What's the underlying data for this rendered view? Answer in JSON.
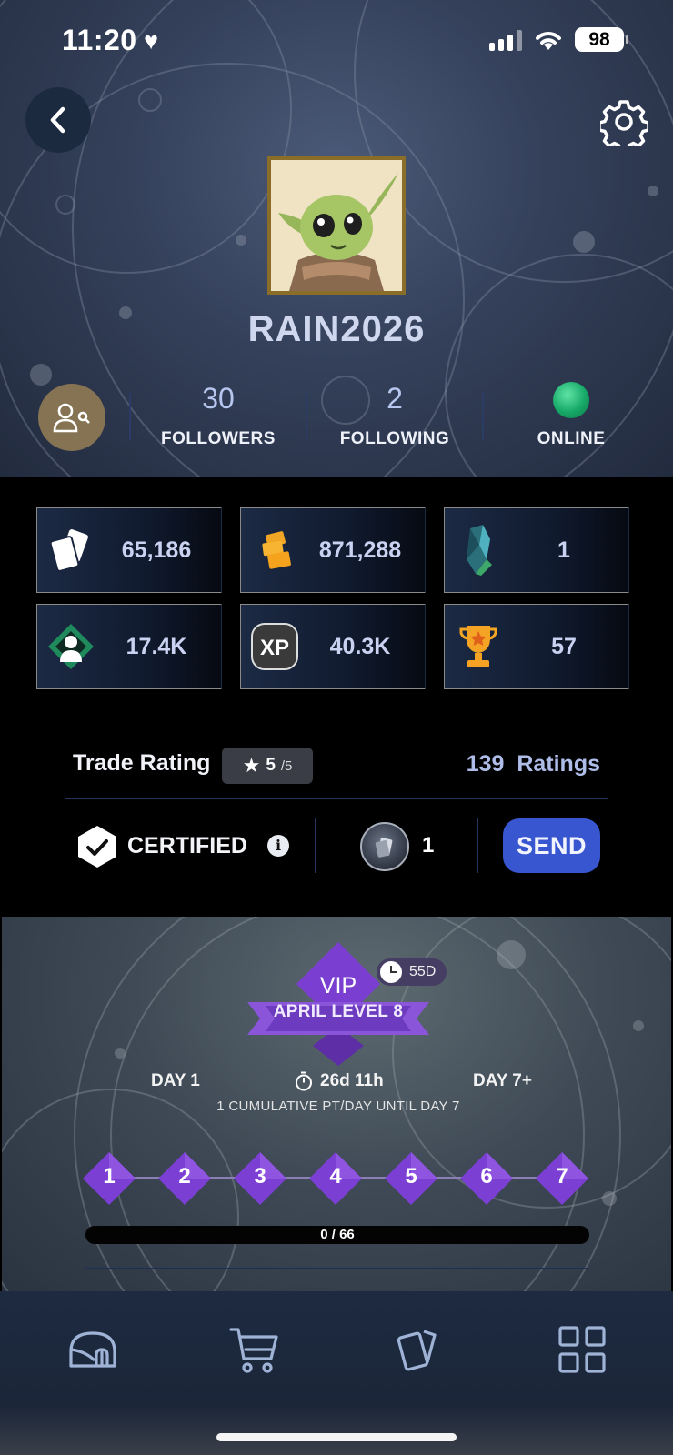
{
  "status_bar": {
    "time": "11:20",
    "battery": "98"
  },
  "profile": {
    "username": "RAIN2026",
    "stats": [
      {
        "value": "30",
        "label": "FOLLOWERS"
      },
      {
        "value": "2",
        "label": "FOLLOWING"
      },
      {
        "value": "",
        "label": "ONLINE"
      }
    ],
    "online_color": "#1fb872"
  },
  "currencies": [
    {
      "icon": "cards-icon",
      "value": "65,186"
    },
    {
      "icon": "ticket-icon",
      "value": "871,288"
    },
    {
      "icon": "crystal-icon",
      "value": "1"
    },
    {
      "icon": "collector-score-icon",
      "value": "17.4K"
    },
    {
      "icon": "xp-icon",
      "value": "40.3K"
    },
    {
      "icon": "trophy-icon",
      "value": "57"
    }
  ],
  "trade": {
    "title": "Trade Rating",
    "rating": "5",
    "rating_max": "/5",
    "ratings_count": "139",
    "ratings_label": "Ratings",
    "certified_label": "CERTIFIED",
    "token_count": "1",
    "send_label": "SEND"
  },
  "vip": {
    "badge": "VIP",
    "level": "APRIL LEVEL 8",
    "time_left": "55D",
    "day_start": "DAY 1",
    "countdown": "26d 11h",
    "day_end": "DAY 7+",
    "note": "1 CUMULATIVE PT/DAY UNTIL DAY 7",
    "days": [
      "1",
      "2",
      "3",
      "4",
      "5",
      "6",
      "7"
    ],
    "progress_text": "0 / 66",
    "progress_fraction": 0
  },
  "nav": [
    "home-icon",
    "cart-icon",
    "cards-icon",
    "grid-icon"
  ],
  "colors": {
    "accent": "#3956d1",
    "vip_purple": "#7b3fd4",
    "brand_gold": "#857354"
  }
}
